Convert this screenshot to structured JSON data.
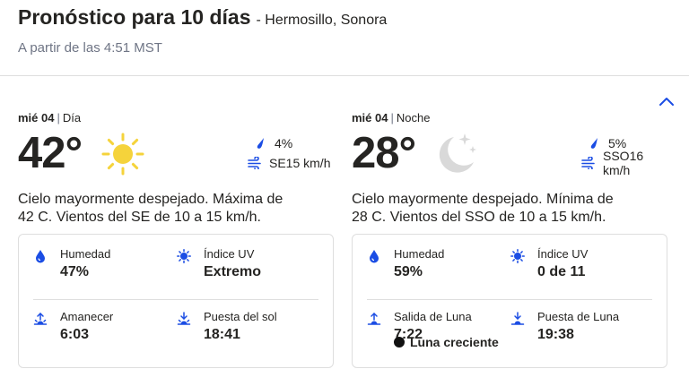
{
  "header": {
    "title": "Pronóstico para 10 días",
    "location": "- Hermosillo, Sonora",
    "subtitle": "A partir de las 4:51 MST"
  },
  "colors": {
    "accent": "#1b4de4",
    "sun": "#f5d33b",
    "moon": "#d9d9d9",
    "text": "#252422",
    "muted": "#6f7585"
  },
  "day": {
    "date": "mié 04",
    "part": "Día",
    "temp": "42°",
    "icon": "sun-icon",
    "precip": "4%",
    "wind": "SE15 km/h",
    "description": "Cielo mayormente despejado. Máxima de 42 C. Vientos del SE de 10 a 15 km/h.",
    "humidity_label": "Humedad",
    "humidity_value": "47%",
    "uv_label": "Índice UV",
    "uv_value": "Extremo",
    "sunrise_label": "Amanecer",
    "sunrise_value": "6:03",
    "sunset_label": "Puesta del sol",
    "sunset_value": "18:41"
  },
  "night": {
    "date": "mié 04",
    "part": "Noche",
    "temp": "28°",
    "icon": "moon-stars-icon",
    "precip": "5%",
    "wind": "SSO16 km/h",
    "description": "Cielo mayormente despejado. Mínima de 28 C. Vientos del SSO de 10 a 15 km/h.",
    "humidity_label": "Humedad",
    "humidity_value": "59%",
    "uv_label": "Índice UV",
    "uv_value": "0 de 11",
    "moonrise_label": "Salida de Luna",
    "moonrise_value": "7:22",
    "moonset_label": "Puesta de Luna",
    "moonset_value": "19:38",
    "moon_phase": "Luna creciente"
  }
}
